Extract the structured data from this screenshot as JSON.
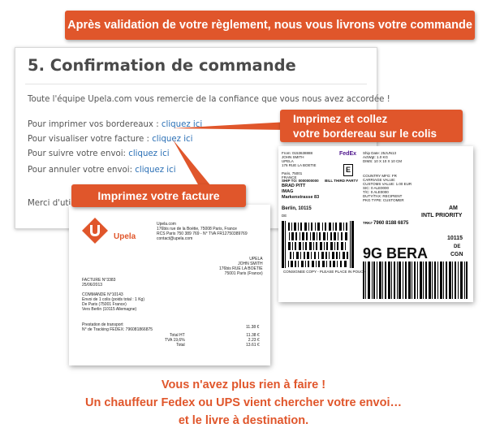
{
  "banners": {
    "top": "Après validation de votre règlement, nous vous livrons votre commande",
    "right_line1": "Imprimez et collez",
    "right_line2": "votre bordereau sur le colis",
    "middle": "Imprimez votre facture"
  },
  "confirmation": {
    "title": "5. Confirmation de commande",
    "thanks": "Toute l'équipe Upela.com vous remercie de la confiance que vous nous avez accordée !",
    "print_labels": "Pour imprimer vos bordereaux :",
    "view_invoice": "Pour visualiser votre facture :",
    "track": "Pour suivre votre envoi:",
    "cancel": "Pour annuler votre envoi:",
    "link": "cliquez ici",
    "closing": "Merci d'utiliser Upela.com."
  },
  "invoice": {
    "brand": "Upela",
    "company": "Upela.com\n176bis rue de la Boétie, 75008 Paris, France\nRCS Paris 750 389 769 - N° TVA FR12750389769\ncontact@upela.com",
    "recipient": "UPELA\nJOHN SMITH\n176bis RUE LA BOETIE\n75001 Paris (France)",
    "facture": "FACTURE N°3383\n25/06/2013",
    "commande": "COMMANDE N°10143\nEnvoi de 1 colis (poids total : 1 Kg)\nDe Paris (75001 France)\nVers Berlin (10115 Allemagne)",
    "prestation": "Prestation de transport\nN° de Tracking FEDEX: 796081866875",
    "prestation_amount": "11.38 €",
    "totals_labels": "Total HT\nTVA 19,6%\nTotal",
    "totals_values": "11.38 €\n2.23 €\n13.61 €"
  },
  "fedex_label": {
    "brand": "FedEx",
    "from": "From: 0153638888\nJOHN SMITH\nUPELA\n176 RUE LA BOETIE\n\nParis, 75001\nFRANCE",
    "ship_to_header": "SHIP TO: 0000000000      BILL THIRD PARTY",
    "ship_to": "BRAD PITT\nIMAG\nMarkenstrasse 83",
    "city": "Berlin,  10115",
    "country": "DE",
    "details": "Ship Date: 25JUN13\nActWgt: 1.0 KG\nDIMS: 10 X 10 X 10 CM",
    "customs": "COUNTRY MFG: FR\nCARRIAGE VALUE:\nCUSTOMS VALUE: 1.00 EUR\nSIC: 0 ALE0000\nT/C: 0 ALE0000\nDUTY/TAX: RECIPIENT\nPKG TYPE: CUSTOMER",
    "service_am": "AM",
    "service": "INTL PRIORITY",
    "trk": "7960 8188 6875",
    "route": "9G BERA",
    "postal": "10115",
    "dest_country": "DE",
    "airport": "CGN",
    "consignee_copy": "CONSIGNEE COPY - PLEASE PLACE IN POUCH"
  },
  "footer": {
    "line1": "Vous n'avez plus rien à faire !",
    "line2": "Un chauffeur Fedex ou UPS vient chercher votre envoi…",
    "line3": "et le livre à destination."
  },
  "colors": {
    "accent": "#e0562b",
    "link": "#2a6fb5",
    "text": "#555555"
  }
}
